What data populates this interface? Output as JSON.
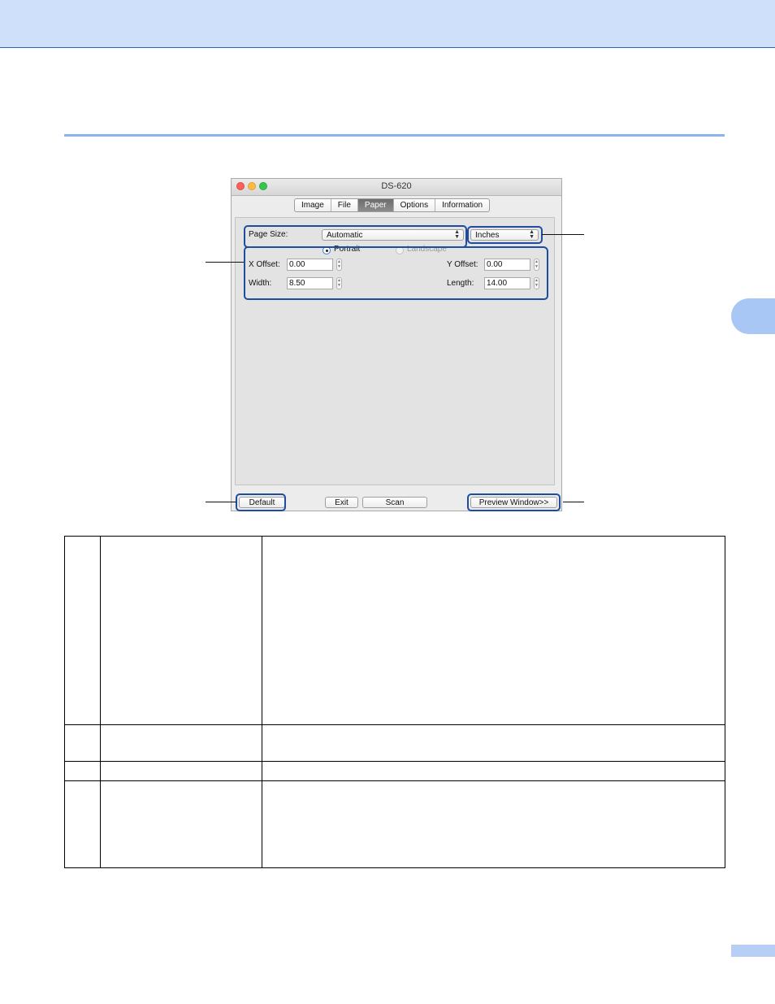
{
  "colors": {
    "header_band": "#cfe0fb",
    "accent_rule": "#8db3ef",
    "side_tab": "#a9c7f5",
    "callout_outline": "#1f4c9e",
    "active_tab": "#7a7a7a"
  },
  "dialog": {
    "title": "DS-620",
    "tabs": [
      {
        "label": "Image"
      },
      {
        "label": "File"
      },
      {
        "label": "Paper"
      },
      {
        "label": "Options"
      },
      {
        "label": "Information"
      }
    ],
    "active_tab": "Paper",
    "page_size": {
      "label": "Page Size:",
      "value": "Automatic"
    },
    "units": {
      "value": "Inches"
    },
    "orientation": {
      "portrait_label": "Portrait",
      "landscape_label": "Landscape",
      "selected": "Portrait"
    },
    "x_offset": {
      "label": "X Offset:",
      "value": "0.00"
    },
    "y_offset": {
      "label": "Y Offset:",
      "value": "0.00"
    },
    "width": {
      "label": "Width:",
      "value": "8.50"
    },
    "length": {
      "label": "Length:",
      "value": "14.00"
    },
    "buttons": {
      "default": "Default",
      "exit": "Exit",
      "scan": "Scan",
      "preview": "Preview Window>>"
    }
  },
  "table": {
    "rows": 4
  }
}
